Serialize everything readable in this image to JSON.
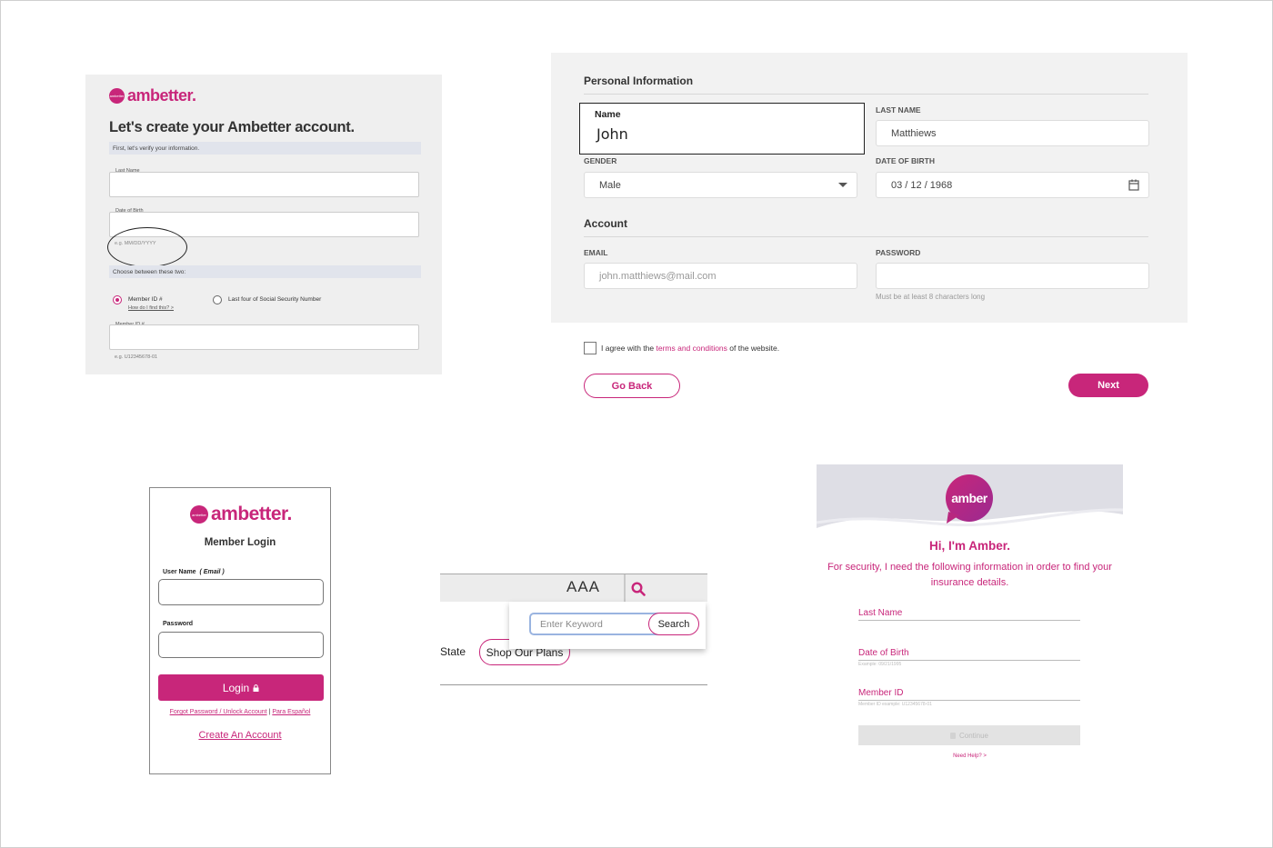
{
  "panel1": {
    "logo_mark": "ambetter",
    "logo_text": "ambetter.",
    "heading": "Let's create your Ambetter account.",
    "verify_band": "First, let's verify your information.",
    "last_name_label": "Last Name",
    "dob_label": "Date of Birth",
    "dob_hint": "e.g. MM/DD/YYYY",
    "choose_band": "Choose between these two:",
    "option_member_id": "Member ID #",
    "option_member_help": "How do I find this? >",
    "option_ssn": "Last four of Social Security Number",
    "member_id_label": "Member ID #",
    "member_id_hint": "e.g. U12345678-01"
  },
  "panel2": {
    "personal_title": "Personal Information",
    "name_label": "Name",
    "name_value": "John",
    "last_name_label": "LAST NAME",
    "last_name_value": "Matthiews",
    "gender_label": "GENDER",
    "gender_value": "Male",
    "dob_label": "DATE OF BIRTH",
    "dob_value": "03 / 12 / 1968",
    "account_title": "Account",
    "email_label": "EMAIL",
    "email_placeholder": "john.matthiews@mail.com",
    "password_label": "PASSWORD",
    "password_help": "Must be at least 8 characters long",
    "agree_pre": "I agree with the ",
    "agree_link": "terms and conditions",
    "agree_post": " of the website.",
    "back_button": "Go Back",
    "next_button": "Next"
  },
  "panel3": {
    "logo_mark": "ambetter",
    "logo_text": "ambetter.",
    "title": "Member Login",
    "username_label": "User Name",
    "username_hint": "( Email )",
    "password_label": "Password",
    "login_button": "Login",
    "forgot_link": "Forgot Password / Unlock Account",
    "separator": "|",
    "spanish_link": "Para Español",
    "create_link": "Create An Account"
  },
  "panel4": {
    "text_size_label": "AAA",
    "keyword_placeholder": "Enter Keyword",
    "search_button": "Search",
    "state_text": "State",
    "shop_button": "Shop Our Plans"
  },
  "panel5": {
    "avatar_text": "amber",
    "greeting": "Hi, I'm Amber.",
    "intro": "For security, I need the following information in order to find your insurance details.",
    "last_name_label": "Last Name",
    "dob_label": "Date of Birth",
    "dob_example": "Example: 09/21/1995",
    "member_id_label": "Member ID",
    "member_id_example": "Member ID example: U12345678-01",
    "continue_button": "Continue",
    "help_link": "Need Help? >"
  },
  "colors": {
    "brand": "#c8267a",
    "panel_gray": "#efefef",
    "band": "#e1e4ec"
  }
}
